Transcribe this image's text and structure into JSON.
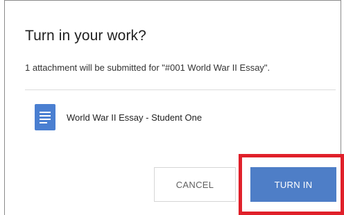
{
  "dialog": {
    "title": "Turn in your work?",
    "subtitle": "1 attachment will be submitted for \"#001 World War II Essay\".",
    "attachment": {
      "icon": "google-doc-icon",
      "name": "World War II Essay - Student One"
    },
    "buttons": {
      "cancel_label": "CANCEL",
      "turn_in_label": "TURN IN"
    }
  },
  "colors": {
    "primary_button": "#4e7ec7",
    "doc_icon": "#4a7fd1",
    "highlight": "#e0202a"
  }
}
